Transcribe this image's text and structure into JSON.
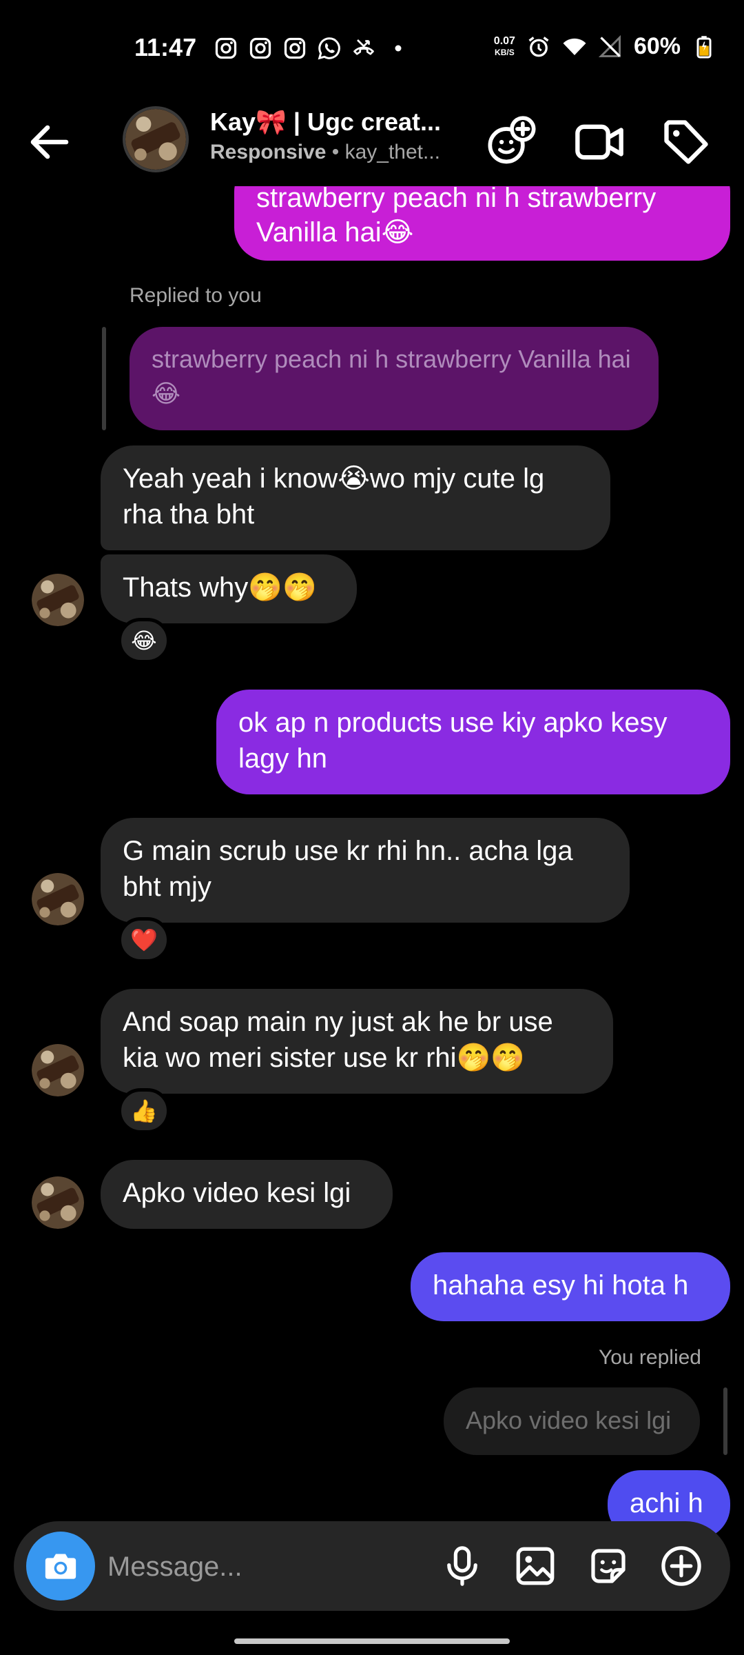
{
  "status_bar": {
    "time": "11:47",
    "net_speed_value": "0.07",
    "net_speed_unit": "KB/S",
    "battery": "60%"
  },
  "header": {
    "name": "Kay🎀 | Ugc creat...",
    "status": "Responsive",
    "username": " • kay_thet..."
  },
  "messages": [
    {
      "id": "m1",
      "direction": "out",
      "text": "strawberry peach ni h strawberry Vanilla hai😂"
    },
    {
      "id": "m2",
      "direction": "in",
      "replied_label": "Replied to you",
      "quoted": "strawberry peach ni h strawberry Vanilla hai😂",
      "text": "Yeah yeah i know😭wo mjy cute lg rha tha bht"
    },
    {
      "id": "m3",
      "direction": "in",
      "text": "Thats why🤭🤭",
      "reaction": "😂"
    },
    {
      "id": "m4",
      "direction": "out",
      "text": "ok ap n products use kiy apko kesy lagy hn"
    },
    {
      "id": "m5",
      "direction": "in",
      "text": "G main scrub use kr rhi hn.. acha lga bht mjy",
      "reaction": "❤️"
    },
    {
      "id": "m6",
      "direction": "in",
      "text": "And soap main ny just ak he br use kia wo meri sister use kr rhi🤭🤭",
      "reaction": "👍"
    },
    {
      "id": "m7",
      "direction": "in",
      "text": "Apko video kesi lgi"
    },
    {
      "id": "m8",
      "direction": "out",
      "text": "hahaha esy hi hota h"
    },
    {
      "id": "m9",
      "direction": "out",
      "replied_label": "You replied",
      "quoted": "Apko video kesi lgi",
      "text": "achi h"
    }
  ],
  "composer": {
    "placeholder": "Message..."
  },
  "colors": {
    "background": "#000000",
    "incoming_bubble": "#262626",
    "outgoing_magenta": "#c81fd6",
    "outgoing_purple": "#8a2be2",
    "outgoing_blue": "#5b4cf0",
    "camera_button": "#3797f0"
  },
  "icons": [
    "back-arrow-icon",
    "add-people-icon",
    "video-call-icon",
    "tag-icon",
    "camera-icon",
    "microphone-icon",
    "gallery-icon",
    "sticker-icon",
    "plus-icon"
  ]
}
